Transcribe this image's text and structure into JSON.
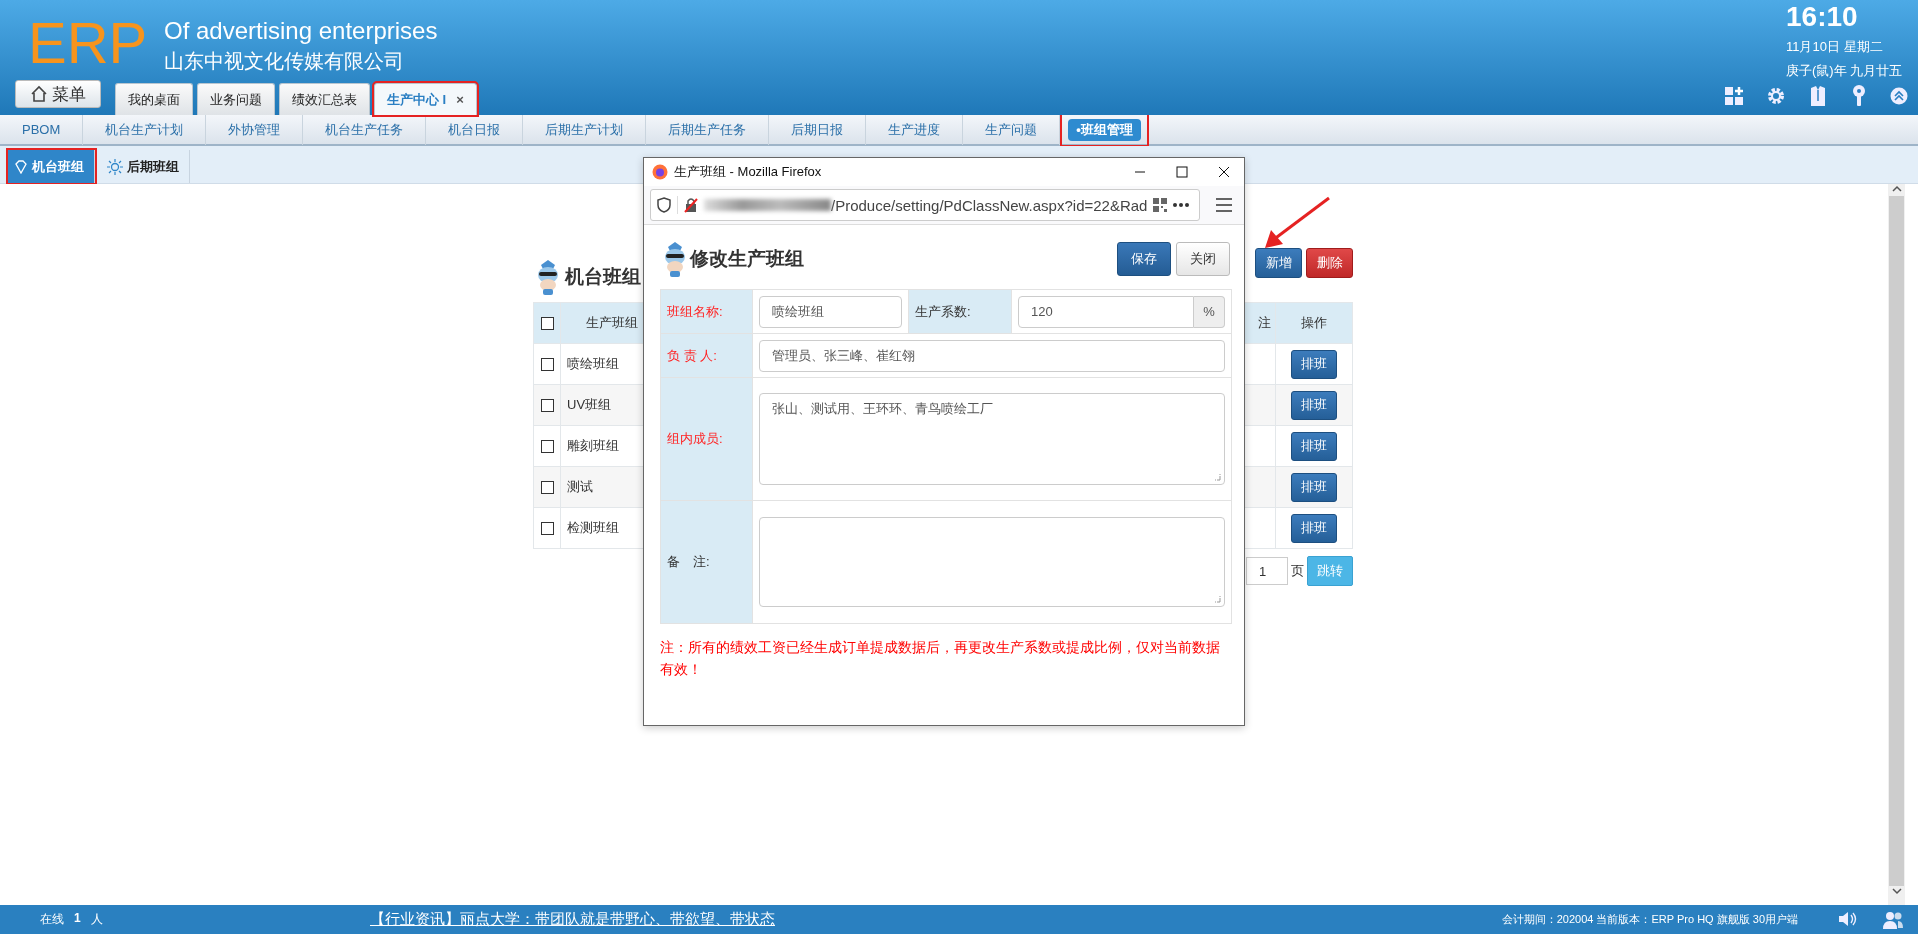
{
  "header": {
    "logo": "ERP",
    "tagline": "Of advertising enterprises",
    "company": "山东中视文化传媒有限公司",
    "clock": {
      "time": "16:10",
      "date": "11月10日 星期二",
      "lunar": "庚子(鼠)年 九月廿五"
    }
  },
  "menu_button": {
    "label": "菜单"
  },
  "tabs": [
    {
      "label": "我的桌面",
      "selected": false,
      "highlighted": false
    },
    {
      "label": "业务问题",
      "selected": false,
      "highlighted": false
    },
    {
      "label": "绩效汇总表",
      "selected": false,
      "highlighted": false
    },
    {
      "label": "生产中心 I",
      "selected": true,
      "highlighted": true,
      "close": "×"
    }
  ],
  "nav": [
    {
      "label": "PBOM",
      "selected": false,
      "highlighted": false
    },
    {
      "label": "机台生产计划",
      "selected": false,
      "highlighted": false
    },
    {
      "label": "外协管理",
      "selected": false,
      "highlighted": false
    },
    {
      "label": "机台生产任务",
      "selected": false,
      "highlighted": false
    },
    {
      "label": "机台日报",
      "selected": false,
      "highlighted": false
    },
    {
      "label": "后期生产计划",
      "selected": false,
      "highlighted": false
    },
    {
      "label": "后期生产任务",
      "selected": false,
      "highlighted": false
    },
    {
      "label": "后期日报",
      "selected": false,
      "highlighted": false
    },
    {
      "label": "生产进度",
      "selected": false,
      "highlighted": false
    },
    {
      "label": "生产问题",
      "selected": false,
      "highlighted": false
    },
    {
      "label": "•班组管理",
      "selected": true,
      "highlighted": true
    }
  ],
  "subtabs": [
    {
      "label": "机台班组",
      "selected": true,
      "highlighted": true
    },
    {
      "label": "后期班组",
      "selected": false,
      "highlighted": false
    }
  ],
  "page": {
    "title": "机台班组",
    "actions": [
      {
        "label": "新增",
        "kind": "primary",
        "arrow_marked": true
      },
      {
        "label": "删除",
        "kind": "danger",
        "arrow_marked": false
      }
    ],
    "table": {
      "header_checked": false,
      "columns": [
        "生产班组",
        "注",
        "操作"
      ],
      "rows": [
        {
          "name": "喷绘班组",
          "checked": false,
          "action": "排班"
        },
        {
          "name": "UV班组",
          "checked": false,
          "action": "排班"
        },
        {
          "name": "雕刻班组",
          "checked": false,
          "action": "排班"
        },
        {
          "name": "测试",
          "checked": false,
          "action": "排班"
        },
        {
          "name": "检测班组",
          "checked": false,
          "action": "排班"
        }
      ]
    },
    "pager": {
      "page": "1",
      "unit": "页",
      "button": "跳转"
    }
  },
  "popup": {
    "title": "生产班组 - Mozilla Firefox",
    "url": "/Produce/setting/PdClassNew.aspx?id=22&Rad",
    "form_title": "修改生产班组",
    "buttons": [
      {
        "label": "保存",
        "kind": "primary"
      },
      {
        "label": "关闭",
        "kind": "default"
      }
    ],
    "fields": [
      {
        "label": "班组名称:",
        "required": true,
        "value": "喷绘班组",
        "kind": "input",
        "extra_label": "生产系数:",
        "extra_value": "120",
        "extra_suffix": "%"
      },
      {
        "label": "负 责 人:",
        "required": true,
        "value": "管理员、张三峰、崔红翎",
        "kind": "input"
      },
      {
        "label": "组内成员:",
        "required": true,
        "value": "张山、测试用、王环环、青鸟喷绘工厂",
        "kind": "textarea"
      },
      {
        "label": "备　注:",
        "required": false,
        "kind": "textarea"
      }
    ],
    "note": "注：所有的绩效工资已经生成订单提成数据后，再更改生产系数或提成比例，仅对当前数据有效！"
  },
  "status_bar": {
    "online_label": "在线",
    "online_count": "1",
    "online_unit": "人",
    "news": "【行业资讯】丽点大学：带团队就是带野心、带欲望、带状态",
    "info": "会计期间：202004 当前版本：ERP Pro HQ 旗舰版 30用户端"
  }
}
